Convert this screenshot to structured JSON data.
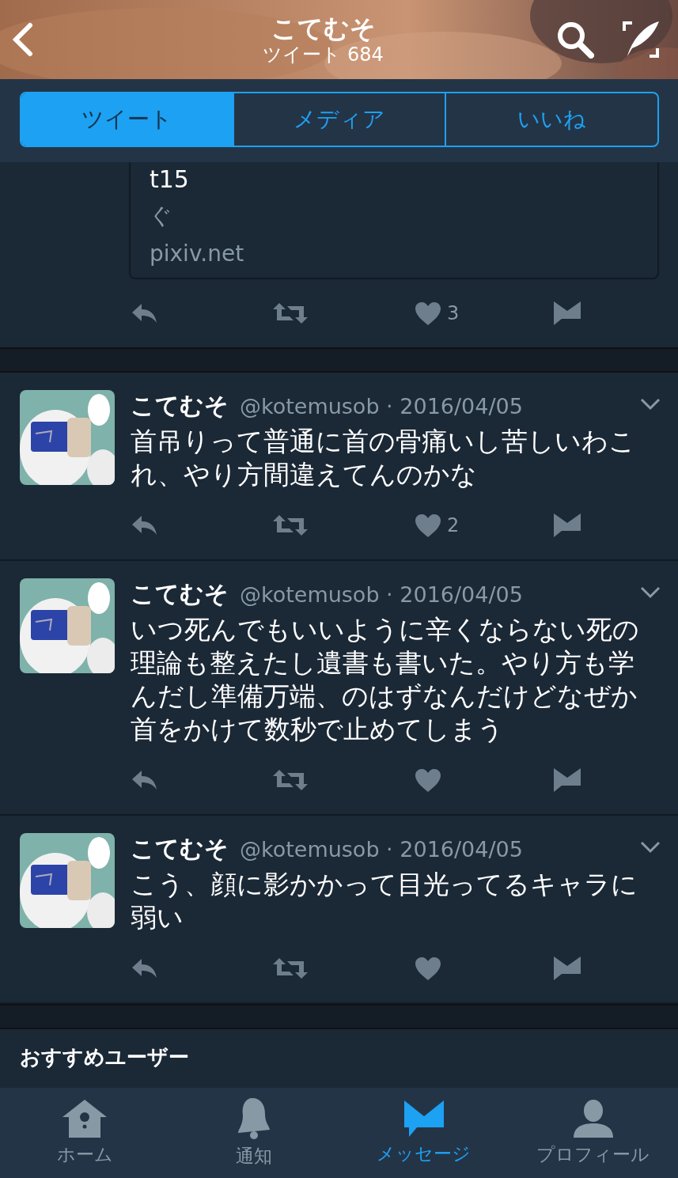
{
  "header": {
    "title": "こてむそ",
    "subtitle": "ツイート 684"
  },
  "tabs": [
    {
      "label": "ツイート",
      "selected": true
    },
    {
      "label": "メディア",
      "selected": false
    },
    {
      "label": "いいね",
      "selected": false
    }
  ],
  "link_card": {
    "title": "t15",
    "description": "ぐ",
    "domain": "pixiv.net",
    "likes": "3"
  },
  "tweets": [
    {
      "name": "こてむそ",
      "meta": "@kotemusob · 2016/04/05",
      "text": "首吊りって普通に首の骨痛いし苦しいわこれ、やり方間違えてんのかな",
      "likes": "2"
    },
    {
      "name": "こてむそ",
      "meta": "@kotemusob · 2016/04/05",
      "text": "いつ死んでもいいように辛くならない死の理論も整えたし遺書も書いた。やり方も学んだし準備万端、のはずなんだけどなぜか首をかけて数秒で止めてしまう"
    },
    {
      "name": "こてむそ",
      "meta": "@kotemusob · 2016/04/05",
      "text": "こう、顔に影かかって目光ってるキャラに弱い"
    }
  ],
  "section_title": "おすすめユーザー",
  "bottom_tabs": [
    {
      "kind": "home",
      "label": "ホーム",
      "selected": false
    },
    {
      "kind": "bell",
      "label": "通知",
      "selected": false
    },
    {
      "kind": "message",
      "label": "メッセージ",
      "selected": true
    },
    {
      "kind": "profile",
      "label": "プロフィール",
      "selected": false
    }
  ]
}
